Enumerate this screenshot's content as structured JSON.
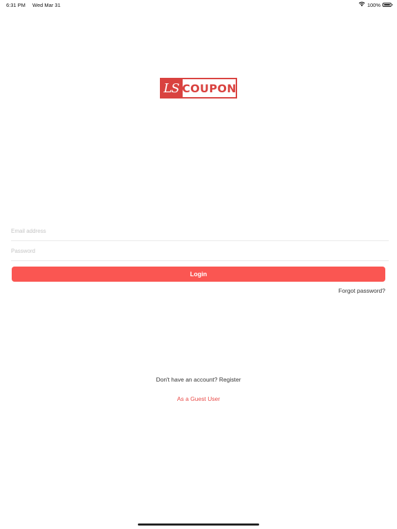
{
  "status_bar": {
    "time": "6:31 PM",
    "date": "Wed Mar 31",
    "battery_text": "100%",
    "icons": [
      "wifi-icon",
      "battery-icon"
    ]
  },
  "logo": {
    "mark": "LS",
    "word": "COUPON",
    "color": "#d9423f"
  },
  "form": {
    "email_placeholder": "Email address",
    "email_value": "",
    "password_placeholder": "Password",
    "password_value": "",
    "login_label": "Login",
    "forgot_label": "Forgot password?"
  },
  "footer": {
    "register_text": "Don't have an account? Register",
    "guest_label": "As a Guest User"
  },
  "colors": {
    "accent": "#fa5652",
    "link": "#e94a47"
  }
}
